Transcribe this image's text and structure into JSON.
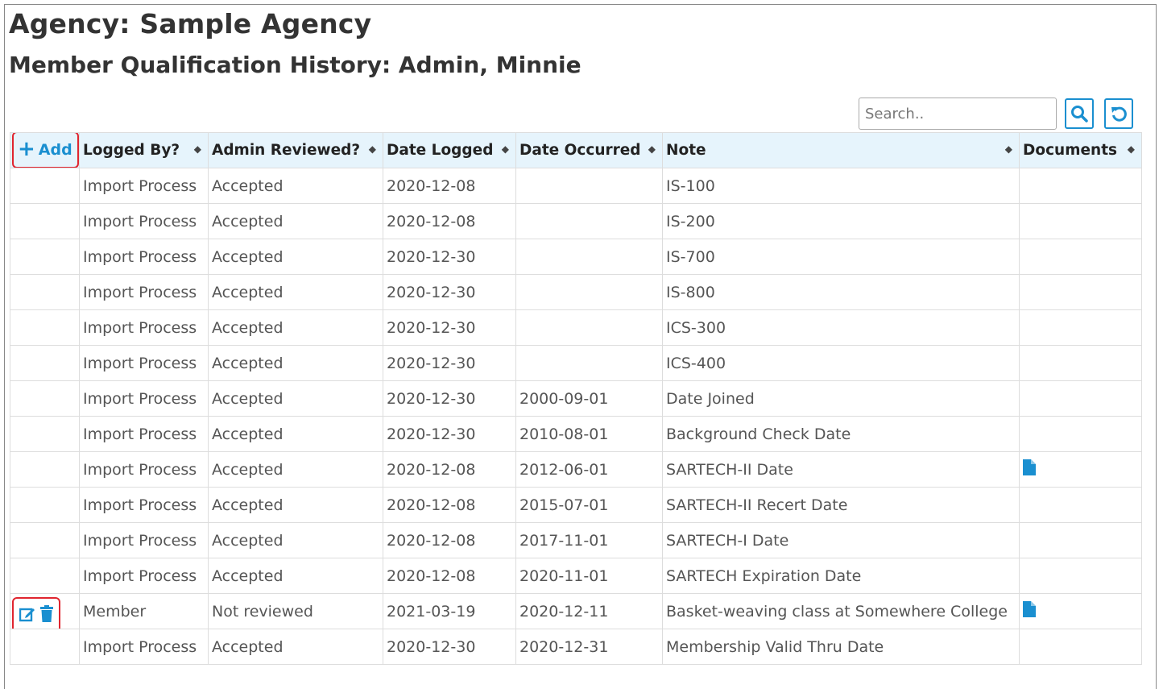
{
  "agency_title": "Agency: Sample Agency",
  "history_title": "Member Qualification History: Admin, Minnie",
  "search": {
    "placeholder": "Search.."
  },
  "icons": {
    "search": "search-icon",
    "reset": "reset-icon",
    "add": "plus-icon",
    "edit": "edit-icon",
    "delete": "trash-icon",
    "document": "file-icon"
  },
  "accent_color": "#1a8fd0",
  "highlight_color": "#e0252f",
  "table": {
    "add_label": "Add",
    "headers": [
      "Logged By?",
      "Admin Reviewed?",
      "Date Logged",
      "Date Occurred",
      "Note",
      "Documents"
    ],
    "rows": [
      {
        "logged_by": "Import Process",
        "reviewed": "Accepted",
        "date_logged": "2020-12-08",
        "date_occurred": "",
        "note": "IS-100",
        "has_doc": false,
        "editable": false
      },
      {
        "logged_by": "Import Process",
        "reviewed": "Accepted",
        "date_logged": "2020-12-08",
        "date_occurred": "",
        "note": "IS-200",
        "has_doc": false,
        "editable": false
      },
      {
        "logged_by": "Import Process",
        "reviewed": "Accepted",
        "date_logged": "2020-12-30",
        "date_occurred": "",
        "note": "IS-700",
        "has_doc": false,
        "editable": false
      },
      {
        "logged_by": "Import Process",
        "reviewed": "Accepted",
        "date_logged": "2020-12-30",
        "date_occurred": "",
        "note": "IS-800",
        "has_doc": false,
        "editable": false
      },
      {
        "logged_by": "Import Process",
        "reviewed": "Accepted",
        "date_logged": "2020-12-30",
        "date_occurred": "",
        "note": "ICS-300",
        "has_doc": false,
        "editable": false
      },
      {
        "logged_by": "Import Process",
        "reviewed": "Accepted",
        "date_logged": "2020-12-30",
        "date_occurred": "",
        "note": "ICS-400",
        "has_doc": false,
        "editable": false
      },
      {
        "logged_by": "Import Process",
        "reviewed": "Accepted",
        "date_logged": "2020-12-30",
        "date_occurred": "2000-09-01",
        "note": "Date Joined",
        "has_doc": false,
        "editable": false
      },
      {
        "logged_by": "Import Process",
        "reviewed": "Accepted",
        "date_logged": "2020-12-30",
        "date_occurred": "2010-08-01",
        "note": "Background Check Date",
        "has_doc": false,
        "editable": false
      },
      {
        "logged_by": "Import Process",
        "reviewed": "Accepted",
        "date_logged": "2020-12-08",
        "date_occurred": "2012-06-01",
        "note": "SARTECH-II Date",
        "has_doc": true,
        "editable": false
      },
      {
        "logged_by": "Import Process",
        "reviewed": "Accepted",
        "date_logged": "2020-12-08",
        "date_occurred": "2015-07-01",
        "note": "SARTECH-II Recert Date",
        "has_doc": false,
        "editable": false
      },
      {
        "logged_by": "Import Process",
        "reviewed": "Accepted",
        "date_logged": "2020-12-08",
        "date_occurred": "2017-11-01",
        "note": "SARTECH-I Date",
        "has_doc": false,
        "editable": false
      },
      {
        "logged_by": "Import Process",
        "reviewed": "Accepted",
        "date_logged": "2020-12-08",
        "date_occurred": "2020-11-01",
        "note": "SARTECH Expiration Date",
        "has_doc": false,
        "editable": false
      },
      {
        "logged_by": "Member",
        "reviewed": "Not reviewed",
        "date_logged": "2021-03-19",
        "date_occurred": "2020-12-11",
        "note": "Basket-weaving class at Somewhere College",
        "has_doc": true,
        "editable": true
      },
      {
        "logged_by": "Import Process",
        "reviewed": "Accepted",
        "date_logged": "2020-12-30",
        "date_occurred": "2020-12-31",
        "note": "Membership Valid Thru Date",
        "has_doc": false,
        "editable": false
      }
    ]
  }
}
